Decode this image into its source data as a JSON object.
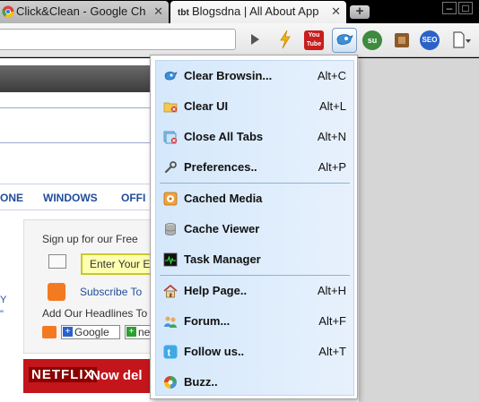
{
  "tabs": [
    {
      "title": "Click&Clean - Google Ch",
      "close": "✕"
    },
    {
      "title": "Blogsdna | All About App",
      "close": "✕"
    }
  ],
  "new_tab_label": "+",
  "window_controls": {
    "minimize": "–",
    "maximize": "□"
  },
  "toolbar": {
    "youtube_label": "You Tube",
    "stumble_label": "su",
    "seo_label": "SEO"
  },
  "page": {
    "nav": [
      "ONE",
      "WINDOWS",
      "OFFI"
    ],
    "signup_text": "Sign up for our Free",
    "email_placeholder": "Enter Your E",
    "subscribe_text": "Subscribe To",
    "headlines_text": "Add Our Headlines To",
    "google_badge": "Google",
    "new_badge": "ne",
    "netflix_logo": "NETFLIX",
    "netflix_text": "Now del",
    "side_marks": [
      "Y",
      "\""
    ]
  },
  "menu": {
    "groups": [
      [
        {
          "label": "Clear Browsin...",
          "shortcut": "Alt+C",
          "icon": "click-clean-icon"
        },
        {
          "label": "Clear UI",
          "shortcut": "Alt+L",
          "icon": "folder-clear-icon"
        },
        {
          "label": "Close All Tabs",
          "shortcut": "Alt+N",
          "icon": "close-tabs-icon"
        },
        {
          "label": "Preferences..",
          "shortcut": "Alt+P",
          "icon": "wrench-icon"
        }
      ],
      [
        {
          "label": "Cached Media",
          "shortcut": "",
          "icon": "media-icon"
        },
        {
          "label": "Cache Viewer",
          "shortcut": "",
          "icon": "database-icon"
        },
        {
          "label": "Task Manager",
          "shortcut": "",
          "icon": "task-manager-icon"
        }
      ],
      [
        {
          "label": "Help Page..",
          "shortcut": "Alt+H",
          "icon": "home-icon"
        },
        {
          "label": "Forum...",
          "shortcut": "Alt+F",
          "icon": "people-icon"
        },
        {
          "label": "Follow us..",
          "shortcut": "Alt+T",
          "icon": "twitter-icon"
        },
        {
          "label": "Buzz..",
          "shortcut": "",
          "icon": "buzz-icon"
        }
      ]
    ]
  },
  "colors": {
    "menu_bg": "#d5e8fb",
    "separator": "#8fb2d6",
    "link_blue": "#1f4d9a",
    "netflix_red": "#c4151c"
  }
}
